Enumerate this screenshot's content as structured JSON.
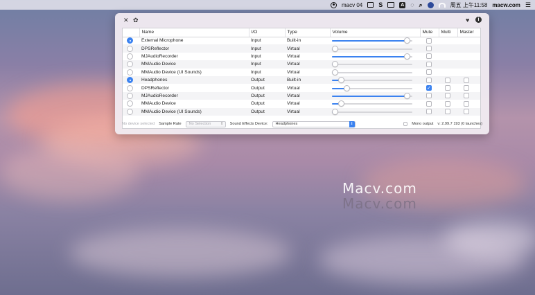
{
  "menubar": {
    "app_label": "macv 04",
    "clock": "周五 上午11:58",
    "site": "macw.com",
    "items": [
      "record-icon",
      "calendar-icon",
      "s-logo-icon",
      "window-icon",
      "a-icon",
      "chat-icon",
      "search-icon",
      "avatar-icon",
      "wifi-icon",
      "list-icon"
    ]
  },
  "panel": {
    "close_glyph": "✕",
    "settings_glyph": "✿",
    "twitter_glyph": "♥",
    "info_glyph": "i",
    "columns": {
      "name": "Name",
      "io": "I/O",
      "type": "Type",
      "volume": "Volume",
      "mute": "Mute",
      "multi": "Multi",
      "master": "Master"
    },
    "rows": [
      {
        "selected": true,
        "name": "External Microphone",
        "io": "Input",
        "type": "Built-in",
        "volume": 0.97,
        "muted": false,
        "has_multi": false
      },
      {
        "selected": false,
        "name": "DPSReflector",
        "io": "Input",
        "type": "Virtual",
        "volume": 0.0,
        "muted": false,
        "has_multi": false
      },
      {
        "selected": false,
        "name": "MJAudioRecorder",
        "io": "Input",
        "type": "Virtual",
        "volume": 0.97,
        "muted": false,
        "has_multi": false
      },
      {
        "selected": false,
        "name": "MMAudio Device",
        "io": "Input",
        "type": "Virtual",
        "volume": 0.0,
        "muted": false,
        "has_multi": false
      },
      {
        "selected": false,
        "name": "MMAudio Device (UI Sounds)",
        "io": "Input",
        "type": "Virtual",
        "volume": 0.0,
        "muted": false,
        "has_multi": false
      },
      {
        "selected": true,
        "name": "Headphones",
        "io": "Output",
        "type": "Built-in",
        "volume": 0.08,
        "muted": false,
        "has_multi": true
      },
      {
        "selected": false,
        "name": "DPSReflector",
        "io": "Output",
        "type": "Virtual",
        "volume": 0.16,
        "muted": true,
        "has_multi": true
      },
      {
        "selected": false,
        "name": "MJAudioRecorder",
        "io": "Output",
        "type": "Virtual",
        "volume": 0.97,
        "muted": false,
        "has_multi": true
      },
      {
        "selected": false,
        "name": "MMAudio Device",
        "io": "Output",
        "type": "Virtual",
        "volume": 0.08,
        "muted": false,
        "has_multi": true
      },
      {
        "selected": false,
        "name": "MMAudio Device (UI Sounds)",
        "io": "Output",
        "type": "Virtual",
        "volume": 0.0,
        "muted": false,
        "has_multi": true
      }
    ],
    "footer": {
      "no_device": "No device selected",
      "sample_rate_label": "Sample Rate",
      "sample_rate_value": "No Selection",
      "sfx_label": "Sound Effects Device:",
      "sfx_value": "Headphones",
      "mono_label": "Mono output",
      "version": "v: 2.99.7 193 (0 launches)"
    }
  },
  "watermark": {
    "line1": "Macv.com",
    "line2": "Macv.com"
  },
  "colors": {
    "accent": "#3b82f0"
  }
}
